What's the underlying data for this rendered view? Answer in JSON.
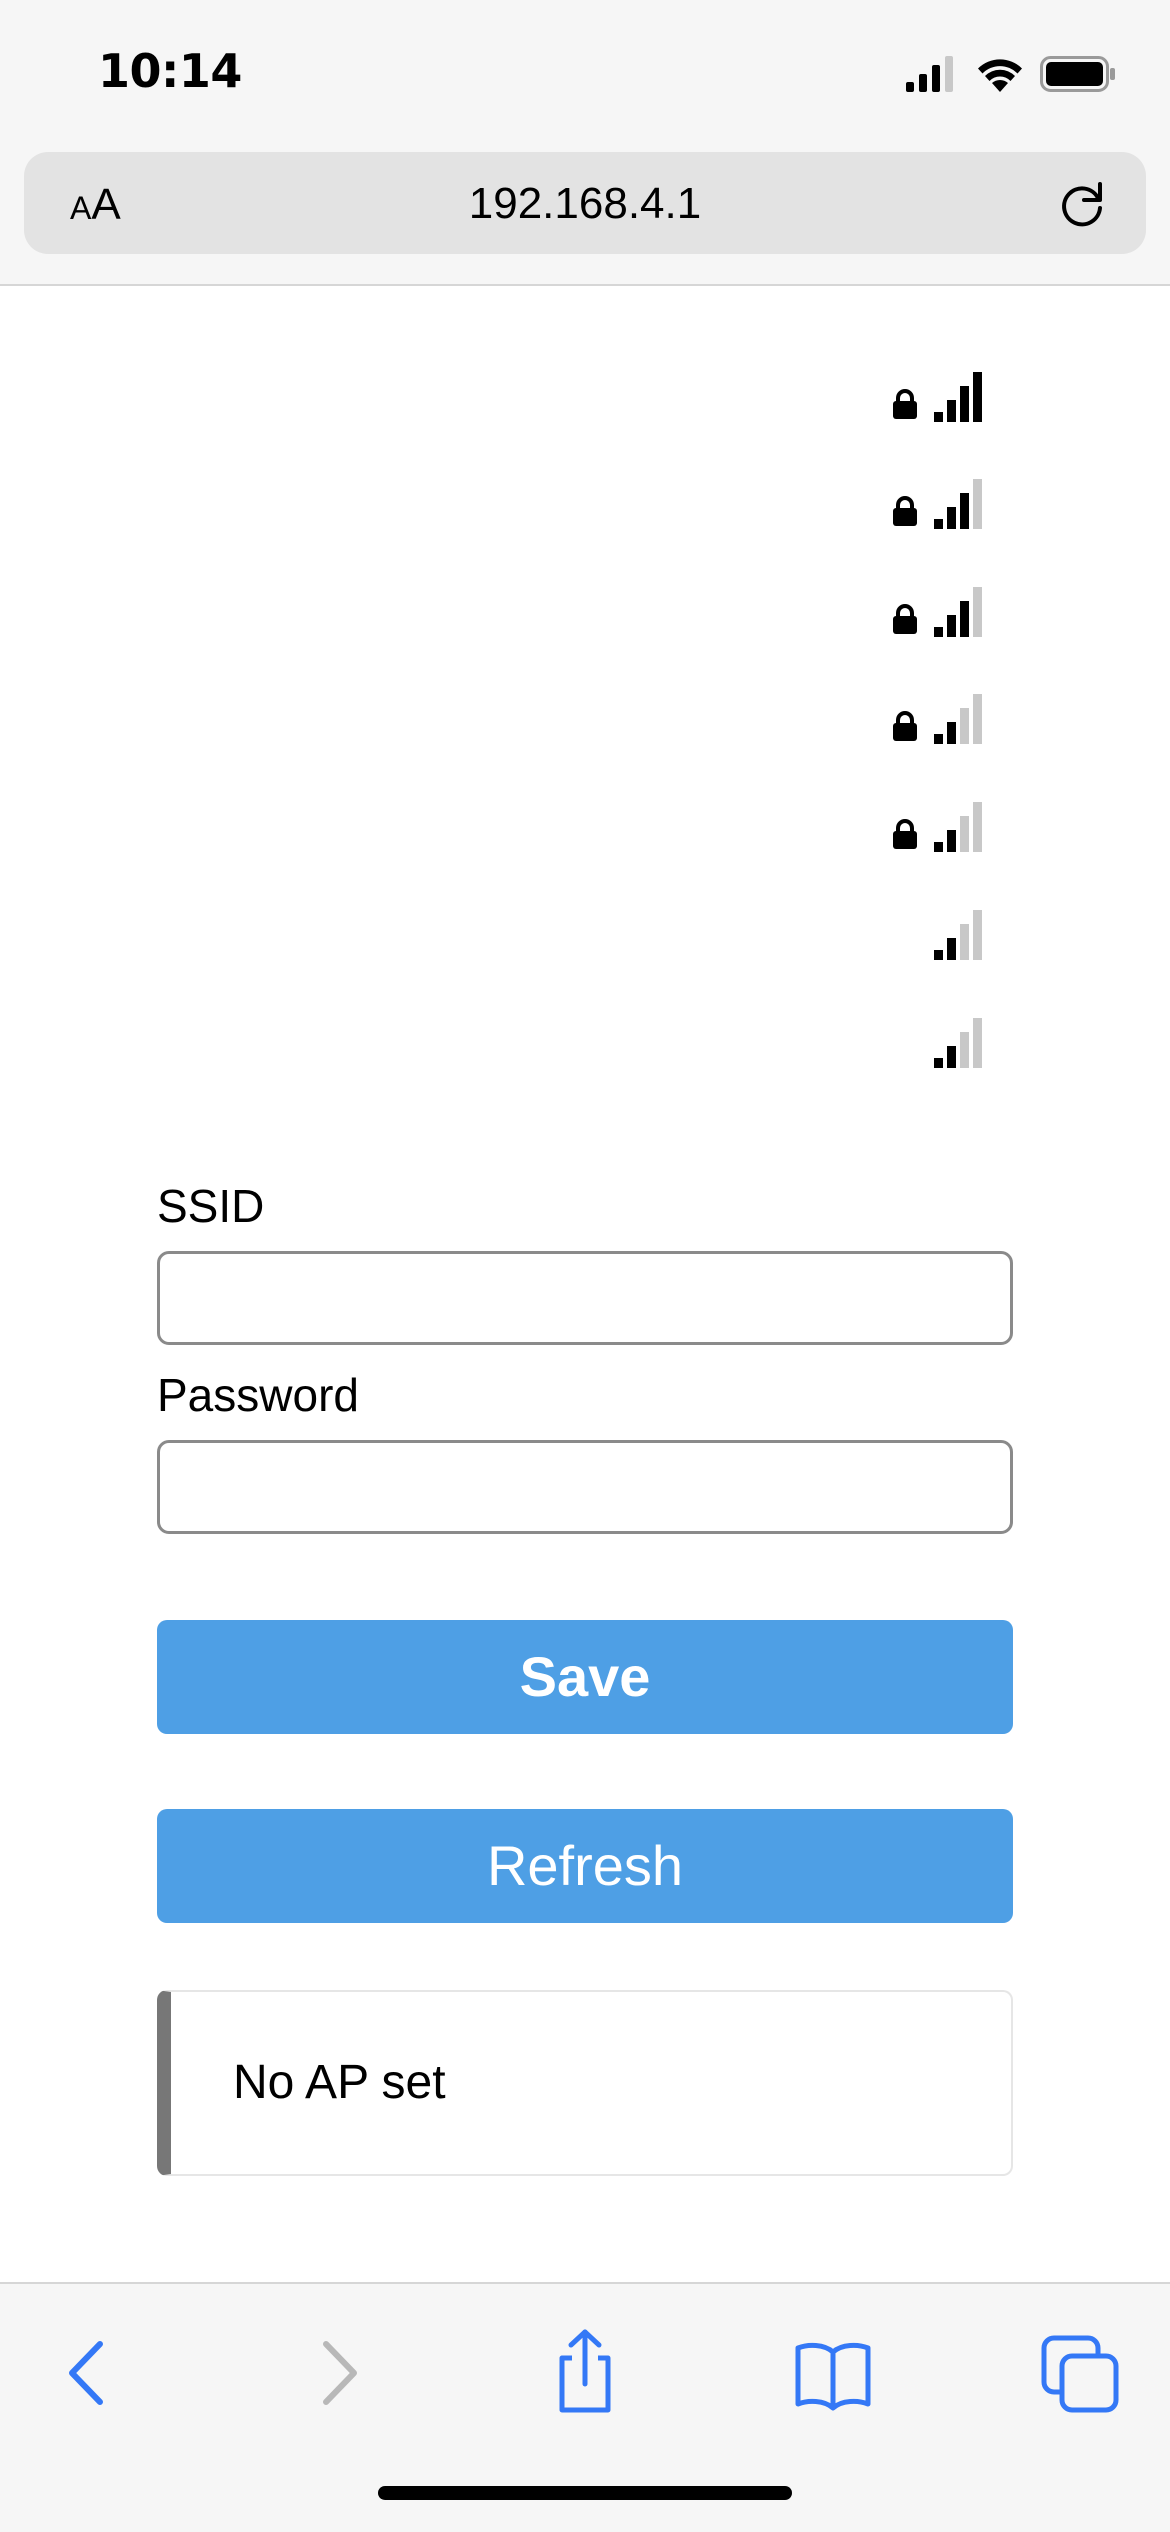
{
  "status_bar": {
    "time": "10:14",
    "icons": [
      "cellular-signal-icon",
      "wifi-icon",
      "battery-icon"
    ]
  },
  "browser": {
    "text_size_small": "A",
    "text_size_large": "A",
    "url": "192.168.4.1",
    "reload_icon": "reload-icon"
  },
  "networks": [
    {
      "ssid": "",
      "secured": true,
      "signal_bars": 4
    },
    {
      "ssid": "",
      "secured": true,
      "signal_bars": 3
    },
    {
      "ssid": "",
      "secured": true,
      "signal_bars": 3
    },
    {
      "ssid": "",
      "secured": true,
      "signal_bars": 2
    },
    {
      "ssid": "",
      "secured": true,
      "signal_bars": 2
    },
    {
      "ssid": "",
      "secured": false,
      "signal_bars": 2
    },
    {
      "ssid": "",
      "secured": false,
      "signal_bars": 2
    }
  ],
  "form": {
    "ssid_label": "SSID",
    "ssid_value": "",
    "password_label": "Password",
    "password_value": "",
    "save_label": "Save",
    "refresh_label": "Refresh"
  },
  "status_message": "No AP set",
  "toolbar": {
    "items": [
      "back-icon",
      "forward-icon",
      "share-icon",
      "bookmarks-icon",
      "tabs-icon"
    ]
  },
  "colors": {
    "button_blue": "#4e9fe5",
    "toolbar_blue": "#3478f6",
    "bar_active": "#000000",
    "bar_inactive": "#c8c8c8",
    "message_border": "#777777"
  }
}
